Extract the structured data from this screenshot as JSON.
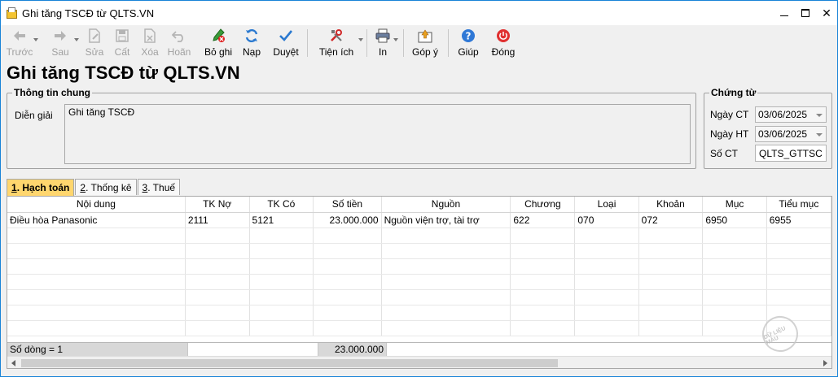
{
  "window": {
    "title": "Ghi tăng TSCĐ từ QLTS.VN",
    "close_glyph": "✕"
  },
  "toolbar": {
    "buttons": [
      {
        "label": "Trước",
        "enabled": false,
        "icon": "arrow-left-icon"
      },
      {
        "label": "Sau",
        "enabled": false,
        "icon": "arrow-right-icon"
      },
      {
        "label": "Sửa",
        "enabled": false,
        "icon": "edit-icon"
      },
      {
        "label": "Cất",
        "enabled": false,
        "icon": "save-icon"
      },
      {
        "label": "Xóa",
        "enabled": false,
        "icon": "delete-icon"
      },
      {
        "label": "Hoãn",
        "enabled": false,
        "icon": "undo-icon"
      },
      {
        "label": "Bỏ ghi",
        "enabled": true,
        "icon": "unpost-icon"
      },
      {
        "label": "Nạp",
        "enabled": true,
        "icon": "refresh-icon"
      },
      {
        "label": "Duyệt",
        "enabled": true,
        "icon": "check-icon"
      },
      {
        "label": "Tiện ích",
        "enabled": true,
        "icon": "tools-icon"
      },
      {
        "label": "In",
        "enabled": true,
        "icon": "printer-icon"
      },
      {
        "label": "Góp ý",
        "enabled": true,
        "icon": "feedback-icon"
      },
      {
        "label": "Giúp",
        "enabled": true,
        "icon": "help-icon"
      },
      {
        "label": "Đóng",
        "enabled": true,
        "icon": "power-icon"
      }
    ]
  },
  "page": {
    "title": "Ghi tăng TSCĐ từ QLTS.VN"
  },
  "general": {
    "group_title": "Thông tin chung",
    "description_label": "Diễn giải",
    "description_value": "Ghi tăng TSCĐ"
  },
  "voucher": {
    "group_title": "Chứng từ",
    "date_label": "Ngày CT",
    "date_value": "03/06/2025",
    "post_date_label": "Ngày HT",
    "post_date_value": "03/06/2025",
    "number_label": "Số CT",
    "number_value": "QLTS_GTTSC"
  },
  "tabs": [
    {
      "key": "1",
      "label": ". Hạch toán",
      "active": true
    },
    {
      "key": "2",
      "label": ". Thống kê",
      "active": false
    },
    {
      "key": "3",
      "label": ". Thuế",
      "active": false
    }
  ],
  "grid": {
    "columns": [
      "Nội dung",
      "TK Nợ",
      "TK Có",
      "Số tiền",
      "Nguồn",
      "Chương",
      "Loại",
      "Khoản",
      "Mục",
      "Tiểu mục"
    ],
    "rows": [
      [
        "Điều hòa Panasonic",
        "2111",
        "5121",
        "23.000.000",
        "Nguồn viện trợ, tài trợ",
        "622",
        "070",
        "072",
        "6950",
        "6955"
      ]
    ],
    "row_count_label": "Số dòng = 1",
    "total_amount": "23.000.000"
  },
  "watermark_text": "DỮ LIỆU MẪU"
}
